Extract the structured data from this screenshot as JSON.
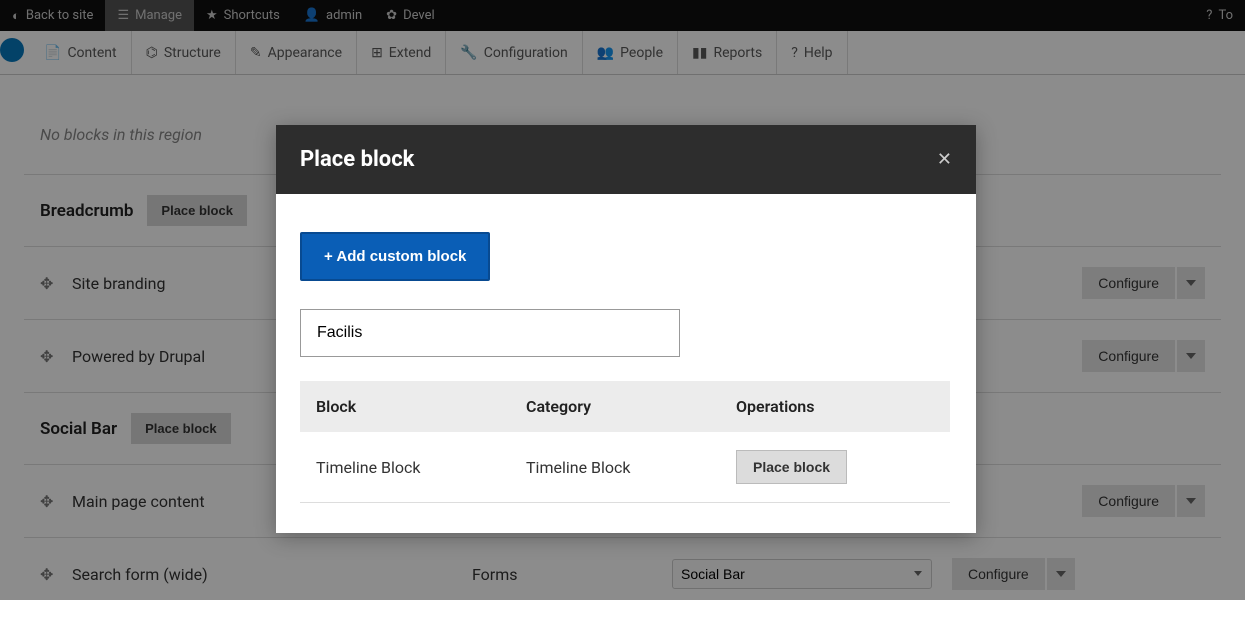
{
  "topbar": {
    "back": "Back to site",
    "manage": "Manage",
    "shortcuts": "Shortcuts",
    "admin": "admin",
    "devel": "Devel",
    "to": "To"
  },
  "menubar": {
    "content": "Content",
    "structure": "Structure",
    "appearance": "Appearance",
    "extend": "Extend",
    "configuration": "Configuration",
    "people": "People",
    "reports": "Reports",
    "help": "Help"
  },
  "page": {
    "no_blocks": "No blocks in this region",
    "place_block_label": "Place block",
    "configure_label": "Configure",
    "regions": {
      "breadcrumb": "Breadcrumb",
      "social_bar": "Social Bar"
    },
    "blocks": [
      {
        "name": "Site branding",
        "category": "",
        "region": ""
      },
      {
        "name": "Powered by Drupal",
        "category": "",
        "region": ""
      },
      {
        "name": "Main page content",
        "category": "",
        "region": ""
      },
      {
        "name": "Search form (wide)",
        "category": "Forms",
        "region": "Social Bar"
      }
    ]
  },
  "dialog": {
    "title": "Place block",
    "add_custom": "+ Add custom block",
    "filter_value": "Facilis",
    "columns": {
      "block": "Block",
      "category": "Category",
      "operations": "Operations"
    },
    "rows": [
      {
        "block": "Timeline Block",
        "category": "Timeline Block"
      }
    ],
    "place_label": "Place block"
  }
}
